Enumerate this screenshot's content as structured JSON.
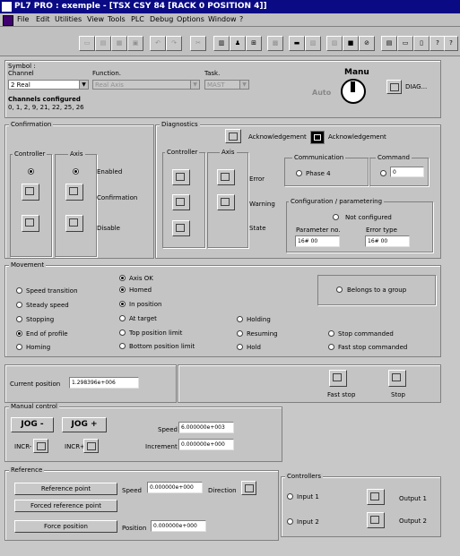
{
  "window": {
    "title": "PL7 PRO : exemple - [TSX CSY 84 [RACK 0    POSITION 4]]"
  },
  "menu": [
    "File",
    "Edit",
    "Utilities",
    "View",
    "Tools",
    "PLC",
    "Debug",
    "Options",
    "Window",
    "?"
  ],
  "toolbar": [
    "new-icon",
    "open-icon",
    "save-icon",
    "print-icon",
    "undo-icon",
    "redo-icon",
    "cut-icon",
    "copy-icon",
    "paste-icon",
    "find-icon",
    "zoom-icon",
    "monitor-icon",
    "table-icon",
    "variables-icon",
    "stop-icon",
    "run-icon",
    "tile-icon",
    "cascade-icon",
    "window-icon",
    "help-icon",
    "context-help-icon"
  ],
  "symbol": {
    "label": "Symbol :",
    "channel_label": "Channel",
    "channel_value": "2  Real",
    "function_label": "Function.",
    "function_value": "Real Axis",
    "task_label": "Task.",
    "task_value": "MAST",
    "channels_configured_label": "Channels configured",
    "channels_configured_value": "0, 1, 2, 9, 21, 22, 25, 26",
    "manu_label": "Manu",
    "auto_label": "Auto",
    "diag_label": "DIAG..."
  },
  "confirmation": {
    "title": "Confirmation",
    "controller_label": "Controller",
    "axis_label": "Axis",
    "enabled_label": "Enabled",
    "confirmation_label": "Confirmation",
    "disable_label": "Disable"
  },
  "diagnostics": {
    "title": "Diagnostics",
    "acknowledgement_btn_label": "Acknowledgement",
    "acknowledgement_label": "Acknowledgement",
    "controller_label": "Controller",
    "axis_label": "Axis",
    "error_label": "Error",
    "warning_label": "Warning",
    "state_label": "State",
    "communication_label": "Communication",
    "phase_label": "Phase 4",
    "command_label": "Command",
    "command_value": "0",
    "config_title": "Configuration / parametering",
    "not_configured_label": "Not configured",
    "param_no_label": "Parameter no.",
    "param_no_value": "16# 00",
    "error_type_label": "Error type",
    "error_type_value": "16# 00"
  },
  "movement": {
    "title": "Movement",
    "axis_ok": "Axis OK",
    "homed": "Homed",
    "in_position": "In position",
    "at_target": "At target",
    "top_limit": "Top position limit",
    "bottom_limit": "Bottom position limit",
    "speed_transition": "Speed transition",
    "steady_speed": "Steady speed",
    "stopping": "Stopping",
    "end_of_profile": "End of profile",
    "homing": "Homing",
    "holding": "Holding",
    "resuming": "Resuming",
    "hold": "Hold",
    "stop_commanded": "Stop commanded",
    "fast_stop_commanded": "Fast stop commanded",
    "belongs_group": "Belongs to a group",
    "current_position_label": "Current position",
    "current_position_value": "1.298396e+006",
    "fast_stop_label": "Fast stop",
    "stop_label": "Stop"
  },
  "manual": {
    "title": "Manual control",
    "jog_minus": "JOG -",
    "jog_plus": "JOG +",
    "incr_minus": "INCR-",
    "incr_plus": "INCR+",
    "speed_label": "Speed",
    "speed_value": "6.000000e+003",
    "increment_label": "Increment",
    "increment_value": "0.000000e+000"
  },
  "reference": {
    "title": "Reference",
    "reference_point_btn": "Reference point",
    "forced_reference_btn": "Forced reference point",
    "force_position_btn": "Force position",
    "speed_label": "Speed",
    "speed_value": "0.000000e+000",
    "direction_label": "Direction",
    "position_label": "Position",
    "position_value": "0.000000e+000"
  },
  "controllers": {
    "title": "Controllers",
    "input1": "Input 1",
    "input2": "Input 2",
    "output1": "Output 1",
    "output2": "Output 2"
  }
}
